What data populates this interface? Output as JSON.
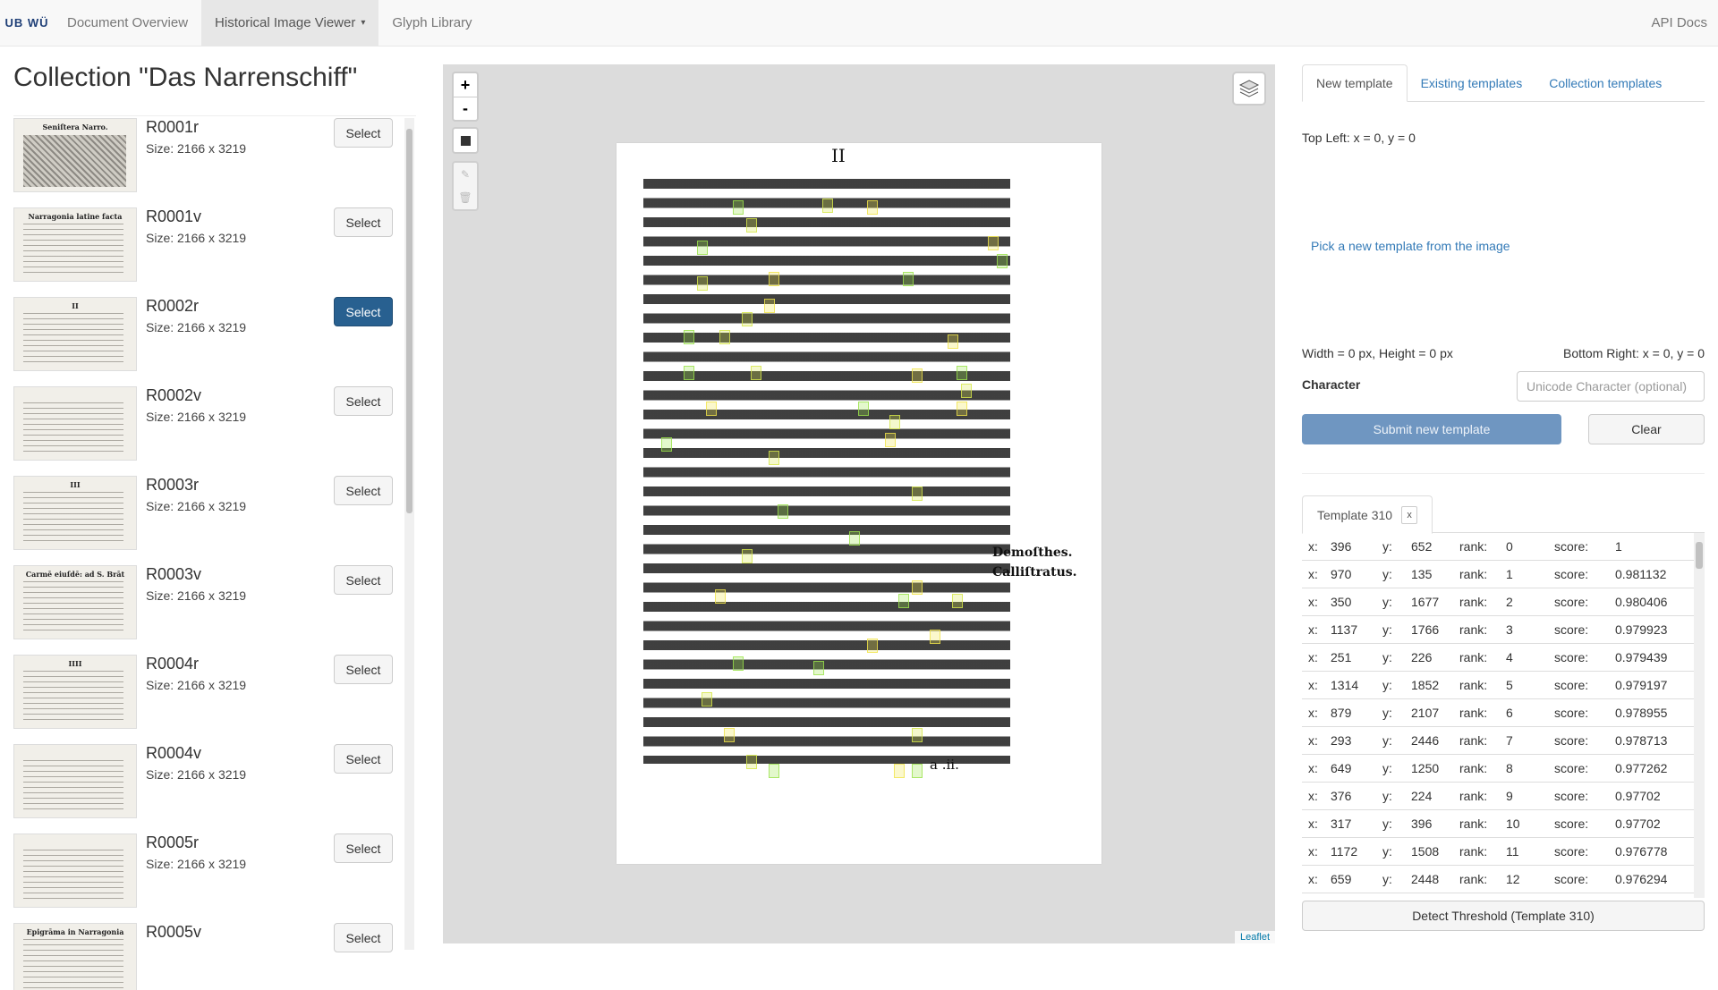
{
  "navbar": {
    "logo": "UB WÜ",
    "items": [
      {
        "label": "Document Overview"
      },
      {
        "label": "Historical Image Viewer",
        "caret": "▾"
      },
      {
        "label": "Glyph Library"
      }
    ],
    "right": "API Docs"
  },
  "collection": {
    "title": "Collection \"Das Narrenschiff\"",
    "items": [
      {
        "name": "R0001r",
        "size": "Size: 2166 x 3219",
        "button": "Select",
        "thumb_title": "Seniſtera Narro."
      },
      {
        "name": "R0001v",
        "size": "Size: 2166 x 3219",
        "button": "Select",
        "thumb_title": "Narragonia latine facta"
      },
      {
        "name": "R0002r",
        "size": "Size: 2166 x 3219",
        "button": "Select",
        "thumb_title": "II"
      },
      {
        "name": "R0002v",
        "size": "Size: 2166 x 3219",
        "button": "Select",
        "thumb_title": ""
      },
      {
        "name": "R0003r",
        "size": "Size: 2166 x 3219",
        "button": "Select",
        "thumb_title": "III"
      },
      {
        "name": "R0003v",
        "size": "Size: 2166 x 3219",
        "button": "Select",
        "thumb_title": "Carmē eiuſdē: ad S. Brāt"
      },
      {
        "name": "R0004r",
        "size": "Size: 2166 x 3219",
        "button": "Select",
        "thumb_title": "IIII"
      },
      {
        "name": "R0004v",
        "size": "Size: 2166 x 3219",
        "button": "Select",
        "thumb_title": ""
      },
      {
        "name": "R0005r",
        "size": "Size: 2166 x 3219",
        "button": "Select",
        "thumb_title": ""
      },
      {
        "name": "R0005v",
        "size": "",
        "button": "Select",
        "thumb_title": "Epigrāma in Narragonia"
      }
    ]
  },
  "viewer": {
    "zoom_in": "+",
    "zoom_out": "-",
    "attribution": "Leaflet",
    "page_number": "II",
    "margin_notes": [
      "Demoſthes.",
      "Calliſtratus."
    ],
    "signature": "a .ii."
  },
  "template_panel": {
    "tabs": [
      "New template",
      "Existing templates",
      "Collection templates"
    ],
    "top_left": "Top Left: x = 0, y = 0",
    "pick_link": "Pick a new template from the image",
    "width_height": "Width = 0 px, Height = 0 px",
    "bottom_right": "Bottom Right: x = 0, y = 0",
    "character_label": "Character",
    "character_placeholder": "Unicode Character (optional)",
    "submit": "Submit new template",
    "clear": "Clear",
    "result_tab": "Template 310",
    "result_tab_close": "x",
    "detect": "Detect Threshold (Template 310)",
    "results": [
      {
        "x": "396",
        "y": "652",
        "rank": "0",
        "score": "1"
      },
      {
        "x": "970",
        "y": "135",
        "rank": "1",
        "score": "0.981132"
      },
      {
        "x": "350",
        "y": "1677",
        "rank": "2",
        "score": "0.980406"
      },
      {
        "x": "1137",
        "y": "1766",
        "rank": "3",
        "score": "0.979923"
      },
      {
        "x": "251",
        "y": "226",
        "rank": "4",
        "score": "0.979439"
      },
      {
        "x": "1314",
        "y": "1852",
        "rank": "5",
        "score": "0.979197"
      },
      {
        "x": "879",
        "y": "2107",
        "rank": "6",
        "score": "0.978955"
      },
      {
        "x": "293",
        "y": "2446",
        "rank": "7",
        "score": "0.978713"
      },
      {
        "x": "649",
        "y": "1250",
        "rank": "8",
        "score": "0.977262"
      },
      {
        "x": "376",
        "y": "224",
        "rank": "9",
        "score": "0.97702"
      },
      {
        "x": "317",
        "y": "396",
        "rank": "10",
        "score": "0.97702"
      },
      {
        "x": "1172",
        "y": "1508",
        "rank": "11",
        "score": "0.976778"
      },
      {
        "x": "659",
        "y": "2448",
        "rank": "12",
        "score": "0.976294"
      }
    ],
    "labels": {
      "x": "x:",
      "y": "y:",
      "rank": "rank:",
      "score": "score:"
    }
  }
}
